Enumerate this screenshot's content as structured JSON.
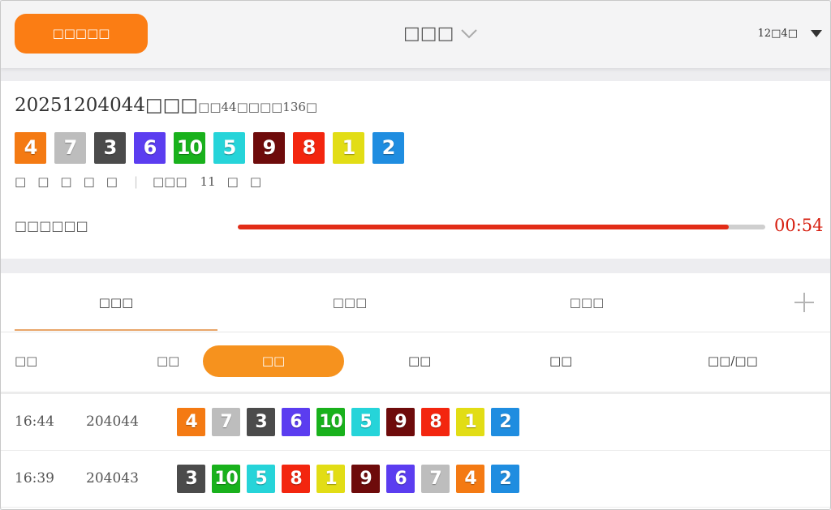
{
  "header": {
    "left_button": "□□□□□",
    "title": "□□□",
    "user": "12□4□"
  },
  "draw": {
    "title": "20251204044□□□",
    "subtitle": "□□44□□□□136□",
    "balls": [
      "4",
      "7",
      "3",
      "6",
      "10",
      "5",
      "9",
      "8",
      "1",
      "2"
    ],
    "stats_left": [
      "□",
      "□",
      "□",
      "□",
      "□"
    ],
    "stats_sep": "|",
    "stats_label": "□□□",
    "stats_value": "11",
    "stats_right": [
      "□",
      "□"
    ],
    "countdown_label": "□□□□□□",
    "countdown": "00:54",
    "progress": 0.93
  },
  "tabs": [
    {
      "label": "□□□",
      "active": true
    },
    {
      "label": "□□□",
      "active": false
    },
    {
      "label": "□□□",
      "active": false
    }
  ],
  "columns": {
    "time": "□□",
    "issue": "□□",
    "active_option": "□□",
    "opt2": "□□",
    "opt3": "□□",
    "opt4": "□□/□□"
  },
  "ball_colors": {
    "1": "#e2dd15",
    "2": "#1f8de0",
    "3": "#4b4b4b",
    "4": "#f47a13",
    "5": "#26d4d9",
    "6": "#5b3df0",
    "7": "#bdbdbd",
    "8": "#f3260f",
    "9": "#6e0b0b",
    "10": "#19b11c"
  },
  "rows": [
    {
      "time": "16:44",
      "issue": "204044",
      "balls": [
        "4",
        "7",
        "3",
        "6",
        "10",
        "5",
        "9",
        "8",
        "1",
        "2"
      ]
    },
    {
      "time": "16:39",
      "issue": "204043",
      "balls": [
        "3",
        "10",
        "5",
        "8",
        "1",
        "9",
        "6",
        "7",
        "4",
        "2"
      ]
    }
  ]
}
